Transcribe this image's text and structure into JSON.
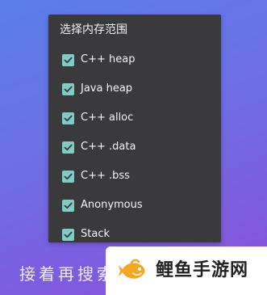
{
  "dialog": {
    "title": "选择内存范围",
    "options": [
      {
        "label": "C++ heap",
        "checked": true
      },
      {
        "label": "Java heap",
        "checked": true
      },
      {
        "label": "C++ alloc",
        "checked": true
      },
      {
        "label": "C++ .data",
        "checked": true
      },
      {
        "label": "C++ .bss",
        "checked": true
      },
      {
        "label": "Anonymous",
        "checked": true
      },
      {
        "label": "Stack",
        "checked": true
      }
    ]
  },
  "bottom_text": "接着再搜索",
  "watermark": {
    "text": "鲤鱼手游网",
    "logo_icon": "carp-fish-icon"
  },
  "colors": {
    "dialog_bg": "#3a3a3c",
    "checkbox": "#80cbc4",
    "background_start": "#5b7fe8",
    "background_end": "#8a4fd9",
    "logo_orange": "#f5a623"
  }
}
